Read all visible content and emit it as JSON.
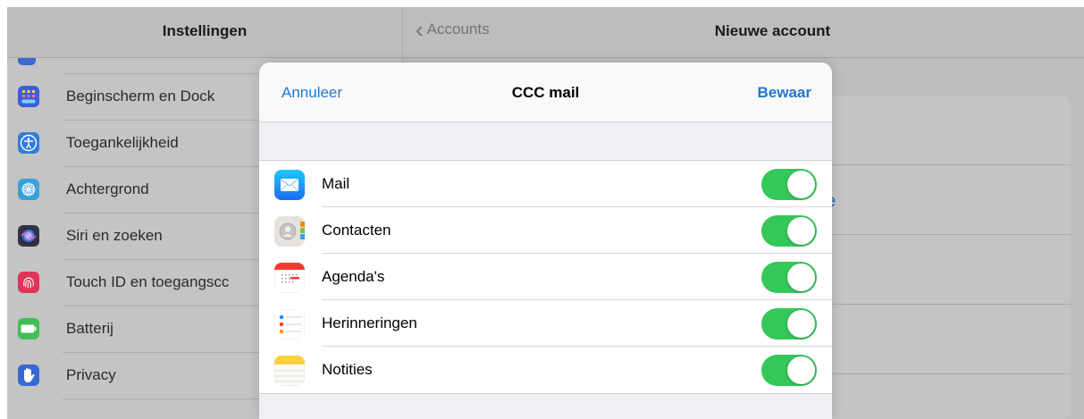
{
  "left_panel": {
    "title": "Instellingen",
    "items": [
      {
        "label": "Beginscherm en Dock",
        "icon": "home-screen-grid-icon",
        "color": "#3c5ed8"
      },
      {
        "label": "Toegankelijkheid",
        "icon": "accessibility-icon",
        "color": "#2f7dde"
      },
      {
        "label": "Achtergrond",
        "icon": "wallpaper-flower-icon",
        "color": "#3aa0d8"
      },
      {
        "label": "Siri en zoeken",
        "icon": "siri-icon",
        "color": "#333344"
      },
      {
        "label": "Touch ID en toegangscc",
        "icon": "fingerprint-icon",
        "color": "#e0345a"
      },
      {
        "label": "Batterij",
        "icon": "battery-icon",
        "color": "#3fbf55"
      },
      {
        "label": "Privacy",
        "icon": "hand-privacy-icon",
        "color": "#3568d4"
      }
    ]
  },
  "right_panel": {
    "back_label": "Accounts",
    "title": "Nieuwe account",
    "partial_text": "ge"
  },
  "modal": {
    "cancel_label": "Annuleer",
    "title": "CCC mail",
    "save_label": "Bewaar",
    "toggles": [
      {
        "label": "Mail",
        "icon": "mail-app-icon",
        "on": true
      },
      {
        "label": "Contacten",
        "icon": "contacts-app-icon",
        "on": true
      },
      {
        "label": "Agenda's",
        "icon": "calendar-app-icon",
        "on": true
      },
      {
        "label": "Herinneringen",
        "icon": "reminders-app-icon",
        "on": true
      },
      {
        "label": "Notities",
        "icon": "notes-app-icon",
        "on": true
      }
    ],
    "toggle_color": "#34c759",
    "accent_color": "#1f78d1"
  }
}
